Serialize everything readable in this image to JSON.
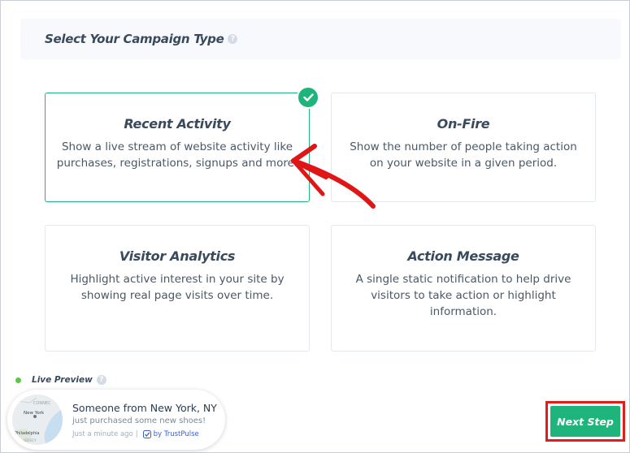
{
  "header": {
    "title": "Select Your Campaign Type",
    "help_icon": "help-circle-icon"
  },
  "cards": [
    {
      "title": "Recent Activity",
      "description": "Show a live stream of website activity like purchases, registrations, signups and more.",
      "selected": true
    },
    {
      "title": "On-Fire",
      "description": "Show the number of people taking action on your website in a given period.",
      "selected": false
    },
    {
      "title": "Visitor Analytics",
      "description": "Highlight active interest in your site by showing real page visits over time.",
      "selected": false
    },
    {
      "title": "Action Message",
      "description": "A single static notification to help drive visitors to take action or highlight information.",
      "selected": false
    }
  ],
  "live_preview": {
    "label": "Live Preview",
    "name": "Someone from New York, NY",
    "action": "just purchased some new shoes!",
    "time": "Just a minute ago",
    "separator": "|",
    "brand": "by TrustPulse",
    "map_labels": {
      "state": "CONNEC",
      "city": "New York",
      "city2": "Philadelphia",
      "state2": "JERSEY"
    }
  },
  "next_button": {
    "label": "Next Step"
  },
  "colors": {
    "accent": "#1fb47b",
    "highlight": "#e31b1b",
    "arrow": "#e01616"
  }
}
